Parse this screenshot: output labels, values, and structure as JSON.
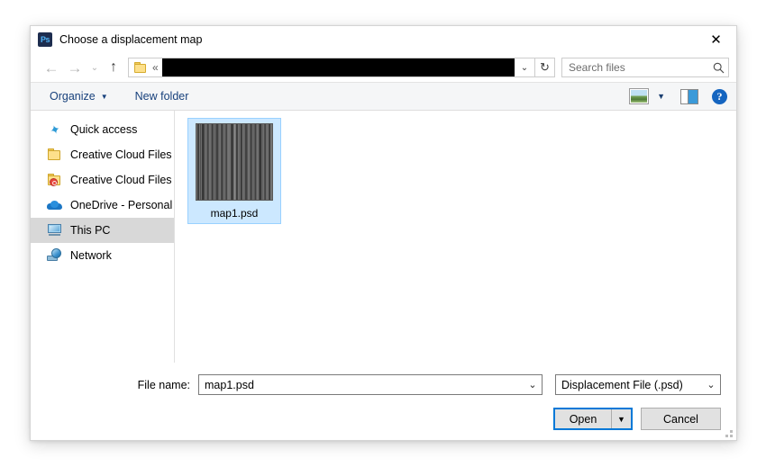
{
  "window": {
    "title": "Choose a displacement map",
    "app_icon": "photoshop-ps-icon",
    "close_label": "✕"
  },
  "navbar": {
    "back_icon": "←",
    "forward_icon": "→",
    "recent_icon": "⌄",
    "up_icon": "↑",
    "address": {
      "folder_icon": "folder-icon",
      "overflow_label": "«",
      "path_value": "",
      "dropdown_icon": "⌄"
    },
    "refresh_icon": "↻",
    "search": {
      "placeholder": "Search files",
      "value": "",
      "icon": "search-icon"
    }
  },
  "toolbar": {
    "organize_label": "Organize",
    "organize_caret": "▼",
    "new_folder_label": "New folder",
    "view_icon": "view-thumbnails-icon",
    "view_caret": "▼",
    "preview_pane_icon": "preview-pane-icon",
    "help_label": "?"
  },
  "sidebar": {
    "items": [
      {
        "label": "Quick access",
        "icon": "star-icon",
        "selected": false
      },
      {
        "label": "Creative Cloud Files",
        "icon": "folder-icon",
        "selected": false
      },
      {
        "label": "Creative Cloud Files P",
        "icon": "folder-cc-icon",
        "selected": false
      },
      {
        "label": "OneDrive - Personal",
        "icon": "cloud-icon",
        "selected": false
      },
      {
        "label": "This PC",
        "icon": "monitor-icon",
        "selected": true
      },
      {
        "label": "Network",
        "icon": "network-icon",
        "selected": false
      }
    ]
  },
  "filelist": {
    "files": [
      {
        "name": "map1.psd",
        "selected": true,
        "thumbnail": "vertical-stripes-displacement-map"
      }
    ]
  },
  "bottom": {
    "filename_label": "File name:",
    "filename_value": "map1.psd",
    "filename_caret": "⌄",
    "filetype_value": "Displacement File (.psd)",
    "filetype_caret": "⌄",
    "open_label": "Open",
    "open_caret": "▼",
    "cancel_label": "Cancel"
  },
  "colors": {
    "accent_blue": "#0078d7",
    "selection_blue": "#cce8ff",
    "toolbar_link": "#18417c",
    "sidebar_selected": "#d8d8d8"
  }
}
